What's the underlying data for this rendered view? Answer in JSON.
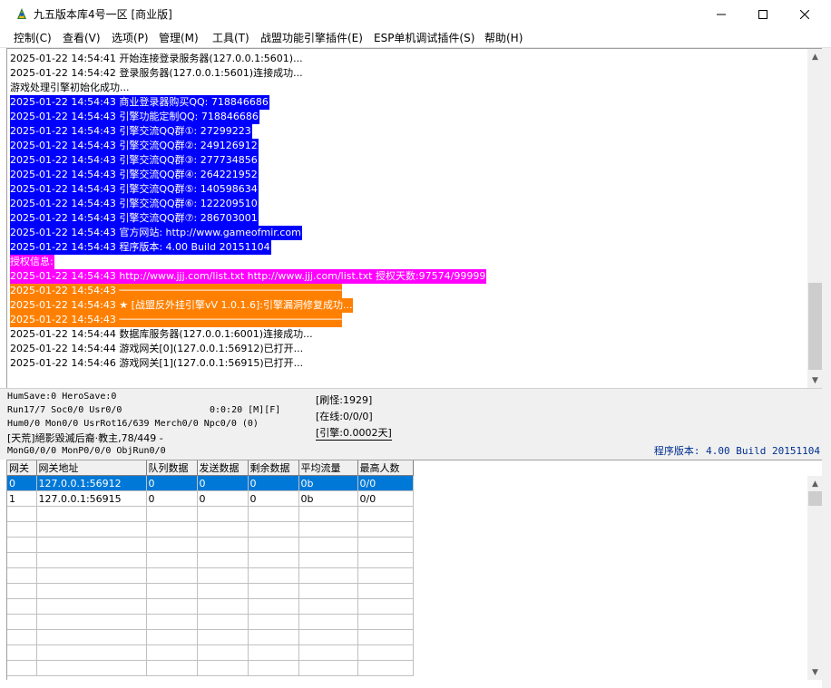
{
  "window": {
    "title": "九五版本库4号一区 [商业版]",
    "icon": "app-icon"
  },
  "menu": [
    "控制(C)",
    "查看(V)",
    "选项(P)",
    "管理(M)",
    "工具(T)",
    "战盟功能引擎插件(E)",
    "ESP单机调试插件(S)",
    "帮助(H)"
  ],
  "log": [
    {
      "text": "2025-01-22 14:54:41 开始连接登录服务器(127.0.0.1:5601)...",
      "bg": "",
      "fg": "#000000"
    },
    {
      "text": "2025-01-22 14:54:42 登录服务器(127.0.0.1:5601)连接成功...",
      "bg": "",
      "fg": "#000000"
    },
    {
      "text": "游戏处理引擎初始化成功...",
      "bg": "",
      "fg": "#000000"
    },
    {
      "text": "2025-01-22 14:54:43 商业登录器购买QQ: 718846686",
      "bg": "#0000ff",
      "fg": "#ffffff"
    },
    {
      "text": "2025-01-22 14:54:43 引擎功能定制QQ: 718846686",
      "bg": "#0000ff",
      "fg": "#ffffff"
    },
    {
      "text": "2025-01-22 14:54:43 引擎交流QQ群①: 27299223",
      "bg": "#0000ff",
      "fg": "#ffffff"
    },
    {
      "text": "2025-01-22 14:54:43 引擎交流QQ群②: 249126912",
      "bg": "#0000ff",
      "fg": "#ffffff"
    },
    {
      "text": "2025-01-22 14:54:43 引擎交流QQ群③: 277734856",
      "bg": "#0000ff",
      "fg": "#ffffff"
    },
    {
      "text": "2025-01-22 14:54:43 引擎交流QQ群④: 264221952",
      "bg": "#0000ff",
      "fg": "#ffffff"
    },
    {
      "text": "2025-01-22 14:54:43 引擎交流QQ群⑤: 140598634",
      "bg": "#0000ff",
      "fg": "#ffffff"
    },
    {
      "text": "2025-01-22 14:54:43 引擎交流QQ群⑥: 122209510",
      "bg": "#0000ff",
      "fg": "#ffffff"
    },
    {
      "text": "2025-01-22 14:54:43 引擎交流QQ群⑦: 286703001",
      "bg": "#0000ff",
      "fg": "#ffffff"
    },
    {
      "text": "2025-01-22 14:54:43 官方网站: http://www.gameofmir.com",
      "bg": "#0000ff",
      "fg": "#ffffff"
    },
    {
      "text": "2025-01-22 14:54:43 程序版本: 4.00 Build 20151104",
      "bg": "#0000ff",
      "fg": "#ffffff"
    },
    {
      "text": "授权信息:",
      "bg": "#ff00ff",
      "fg": "#ffffff"
    },
    {
      "text": "2025-01-22 14:54:43 http://www.jjj.com/list.txt http://www.jjj.com/list.txt 授权天数:97574/99999",
      "bg": "#ff00ff",
      "fg": "#ffffff"
    },
    {
      "text": "2025-01-22 14:54:43 ─────────────────────────────────────",
      "bg": "#ff8000",
      "fg": "#ffffff"
    },
    {
      "text": "2025-01-22 14:54:43 ★ [战盟反外挂引擎vV 1.0.1.6]:引擎漏洞修复成功...",
      "bg": "#ff8000",
      "fg": "#ffffff"
    },
    {
      "text": "2025-01-22 14:54:43 ─────────────────────────────────────",
      "bg": "#ff8000",
      "fg": "#ffffff"
    },
    {
      "text": "2025-01-22 14:54:44 数据库服务器(127.0.0.1:6001)连接成功...",
      "bg": "",
      "fg": "#000000"
    },
    {
      "text": "2025-01-22 14:54:44 游戏网关[0](127.0.0.1:56912)已打开...",
      "bg": "",
      "fg": "#000000"
    },
    {
      "text": "2025-01-22 14:54:46 游戏网关[1](127.0.0.1:56915)已打开...",
      "bg": "",
      "fg": "#000000"
    }
  ],
  "status": {
    "line1": "HumSave:0 HeroSave:0",
    "line2": "Run17/7 Soc0/0 Usr0/0",
    "timer": "0:0:20 [M][F]",
    "line3": "Hum0/0 Mon0/0 UsrRot16/639 Merch0/0 Npc0/0 (0)",
    "line4": "[天荒]絕影毀滅后裔·教主,78/449 -",
    "line5": "MonG0/0/0 MonP0/0/0 ObjRun0/0",
    "refresh": "[刷怪:1929]",
    "online": "[在线:0/0/0]",
    "engine": "[引擎:0.0002天]",
    "version": "程序版本: 4.00 Build 20151104"
  },
  "grid": {
    "headers": [
      "网关",
      "网关地址",
      "队列数据",
      "发送数据",
      "剩余数据",
      "平均流量",
      "最高人数"
    ],
    "rows": [
      [
        "0",
        "127.0.0.1:56912",
        "0",
        "0",
        "0",
        "0b",
        "0/0"
      ],
      [
        "1",
        "127.0.0.1:56915",
        "0",
        "0",
        "0",
        "0b",
        "0/0"
      ]
    ],
    "selected_row": 0
  }
}
